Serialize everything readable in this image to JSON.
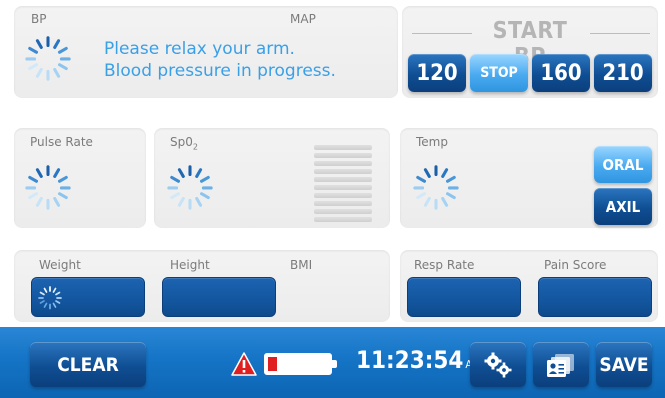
{
  "bp_panel": {
    "bp_label": "BP",
    "map_label": "MAP",
    "message_line1": "Please relax your arm.",
    "message_line2": "Blood pressure in progress."
  },
  "start_bp": {
    "title": "START BP",
    "buttons": [
      "120",
      "STOP",
      "160",
      "210"
    ]
  },
  "vitals": {
    "pulse_rate_label": "Pulse Rate",
    "spo2_label": "Sp0",
    "spo2_subscript": "2",
    "temp_label": "Temp",
    "oral_label": "ORAL",
    "axil_label": "AXIL"
  },
  "measurements": {
    "weight_label": "Weight",
    "height_label": "Height",
    "bmi_label": "BMI",
    "resp_rate_label": "Resp Rate",
    "pain_score_label": "Pain Score"
  },
  "bottom_bar": {
    "clear_label": "CLEAR",
    "time": "11:23:54",
    "ampm": "AM",
    "save_label": "SAVE",
    "battery_level": 0.15
  },
  "colors": {
    "accent": "#1574c6",
    "button_dark": "#0f4e93",
    "button_light": "#4aaaf0",
    "message_text": "#3aa0e6",
    "alert_red": "#e02020"
  },
  "icons": {
    "spinner": "loading-spinner-icon",
    "alert": "warning-triangle-icon",
    "battery": "battery-low-icon",
    "settings": "gears-icon",
    "review": "patient-cards-icon"
  }
}
